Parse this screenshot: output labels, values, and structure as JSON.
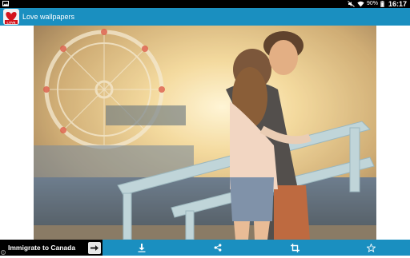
{
  "status_bar": {
    "battery_percent": "90%",
    "time": "16:17",
    "icons": [
      "gallery-notification-icon",
      "mute-icon",
      "wifi-icon",
      "battery-icon"
    ]
  },
  "action_bar": {
    "title": "Love wallpapers",
    "icon": "app-icon-heart",
    "icon_badge": "LOVE"
  },
  "wallpaper": {
    "description_icon": "couple-photo"
  },
  "ad": {
    "text": "Immigrate to Canada",
    "button_icon": "arrow-right-icon",
    "info_icon": "ad-info-icon"
  },
  "bottom_actions": [
    {
      "name": "download",
      "icon": "download-icon"
    },
    {
      "name": "share",
      "icon": "share-icon"
    },
    {
      "name": "crop",
      "icon": "crop-icon"
    },
    {
      "name": "favorite",
      "icon": "star-icon"
    }
  ],
  "colors": {
    "accent": "#1a8fc0",
    "status_bar": "#000000"
  }
}
